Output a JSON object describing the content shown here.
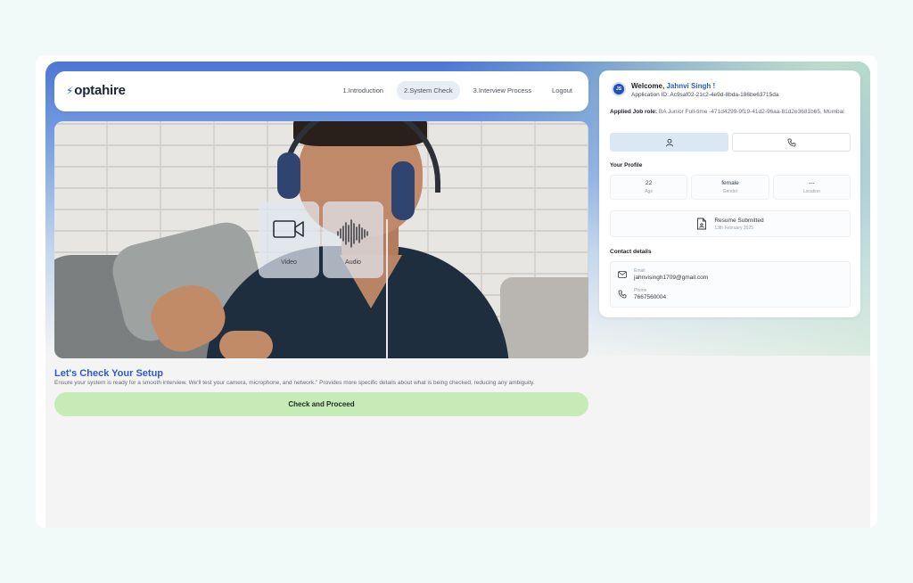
{
  "brand": {
    "logo_text": "optahire",
    "accent": "#2b5cc7"
  },
  "nav": {
    "items": [
      {
        "label": "1.Introduction"
      },
      {
        "label": "2.System Check",
        "active": true
      },
      {
        "label": "3.Interview Process"
      },
      {
        "label": "Logout"
      }
    ]
  },
  "video": {
    "checks": [
      {
        "label": "Video",
        "icon": "video-camera-icon"
      },
      {
        "label": "Audio",
        "icon": "audio-waveform-icon"
      }
    ]
  },
  "setup": {
    "title": "Let's Check Your Setup",
    "description": "Ensure your system is ready for a smooth interview. We'll test your camera, microphone, and network.\" Provides more specific details about what is being checked, reducing any ambiguity.",
    "proceed_label": "Check and Proceed",
    "proceed_color": "#c6ebb7"
  },
  "profile": {
    "avatar_initials": "JS",
    "welcome_prefix": "Welcome,",
    "name": "Jahnvi Singh !",
    "application_id": "Application ID: Ac9saf02-21c2-4e9d-8bda-186be63715da",
    "job_role_label": "Applied Job role:",
    "job_role_value": "BA Junior Full-time -471d4299-9f19-41d2-96aa-81d2e3681b65, Mumbai",
    "your_profile_title": "Your Profile",
    "stats": [
      {
        "value": "22",
        "label": "Age"
      },
      {
        "value": "female",
        "label": "Gender"
      },
      {
        "value": "---",
        "label": "Location"
      }
    ],
    "resume_title": "Resume Submitted",
    "resume_date": "13th February 2025",
    "contact_title": "Contact details",
    "email_label": "Email",
    "email_value": "jahnvisingh1709@gmail.com",
    "phone_label": "Phone",
    "phone_value": "7667560004"
  }
}
